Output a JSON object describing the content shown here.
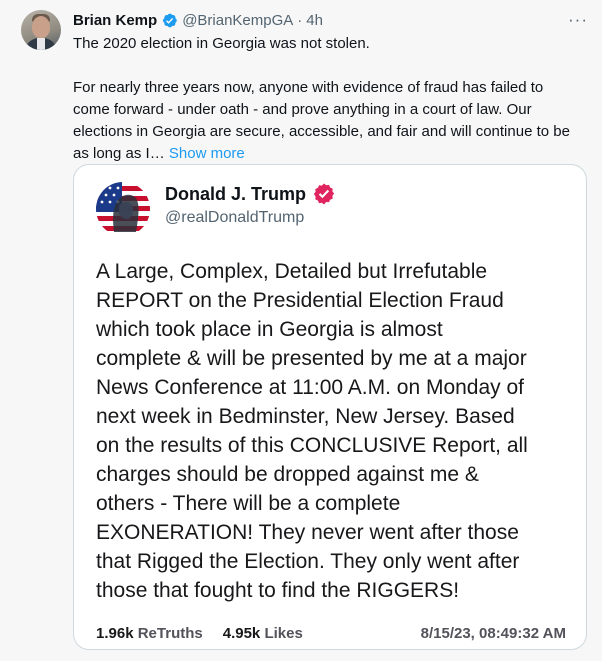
{
  "tweet": {
    "author": {
      "name": "Brian Kemp",
      "handle": "@BrianKempGA",
      "time": "4h",
      "verified_color": "#1d9bf0"
    },
    "separator": "·",
    "more_label": "···",
    "text_lines": [
      "The 2020 election in Georgia was not stolen.",
      "For nearly three years now, anyone with evidence of fraud has failed to",
      "come forward - under oath - and prove anything in a court of law. Our",
      "elections in Georgia are secure, accessible, and fair and will continue to be",
      "as long as I… "
    ],
    "show_more_label": "Show more"
  },
  "quote": {
    "name": "Donald J. Trump",
    "handle": "@realDonaldTrump",
    "badge_color": "#e0245e",
    "body_lines": [
      "A Large, Complex, Detailed but Irrefutable",
      "REPORT on the Presidential Election Fraud",
      "which took place in Georgia is almost",
      "complete & will be presented by me at a major",
      "News Conference at 11:00 A.M. on Monday of",
      "next week in Bedminster, New Jersey. Based",
      "on the results of this CONCLUSIVE Report, all",
      "charges should be dropped against me &",
      "others - There will be a complete",
      "EXONERATION! They never went after those",
      "that Rigged the Election. They only went after",
      "those that fought to find the RIGGERS!"
    ],
    "retruths_count": "1.96k",
    "retruths_label": "ReTruths",
    "likes_count": "4.95k",
    "likes_label": "Likes",
    "timestamp": "8/15/23, 08:49:32 AM"
  }
}
